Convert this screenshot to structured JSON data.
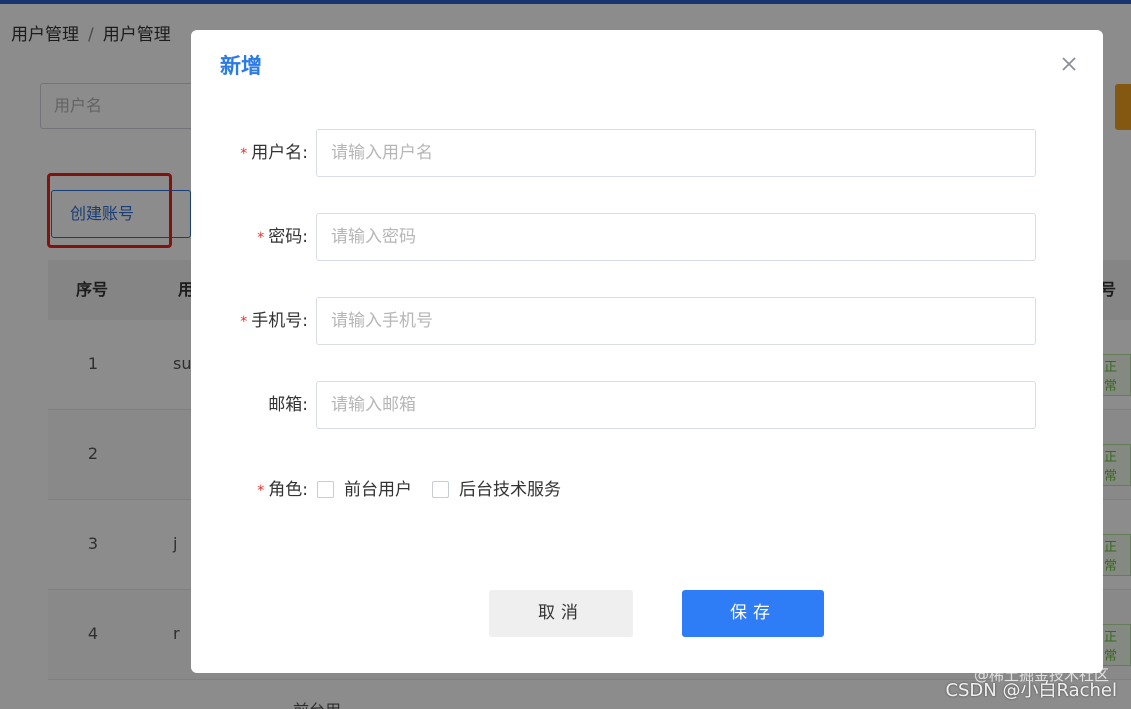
{
  "breadcrumb": [
    "用户管理",
    "用户管理"
  ],
  "breadcrumb_sep": "/",
  "search": {
    "placeholder": "用户名"
  },
  "create_button": "创建账号",
  "table": {
    "headers": {
      "no": "序号",
      "user": "用",
      "status": "号状"
    },
    "rows": [
      {
        "no": "1",
        "user": "su",
        "status": "正常"
      },
      {
        "no": "2",
        "user": "",
        "status": "正常"
      },
      {
        "no": "3",
        "user": "j",
        "status": "正常"
      },
      {
        "no": "4",
        "user": "r",
        "status": "正常"
      }
    ],
    "partial_row_text": "前台用"
  },
  "modal": {
    "title": "新增",
    "fields": [
      {
        "label": "用户名:",
        "required": true,
        "placeholder": "请输入用户名"
      },
      {
        "label": "密码:",
        "required": true,
        "placeholder": "请输入密码"
      },
      {
        "label": "手机号:",
        "required": true,
        "placeholder": "请输入手机号"
      },
      {
        "label": "邮箱:",
        "required": false,
        "placeholder": "请输入邮箱"
      }
    ],
    "role": {
      "label": "角色:",
      "required": true,
      "options": [
        "前台用户",
        "后台技术服务"
      ]
    },
    "cancel_label": "取消",
    "save_label": "保存"
  },
  "watermark": {
    "line1": "@稀土掘金技术社区",
    "line2": "CSDN @小白Rachel"
  },
  "colors": {
    "primary": "#2e7cf6",
    "required": "#e5302c",
    "highlight_box": "#e8261c",
    "status_green": "#67c23a"
  }
}
